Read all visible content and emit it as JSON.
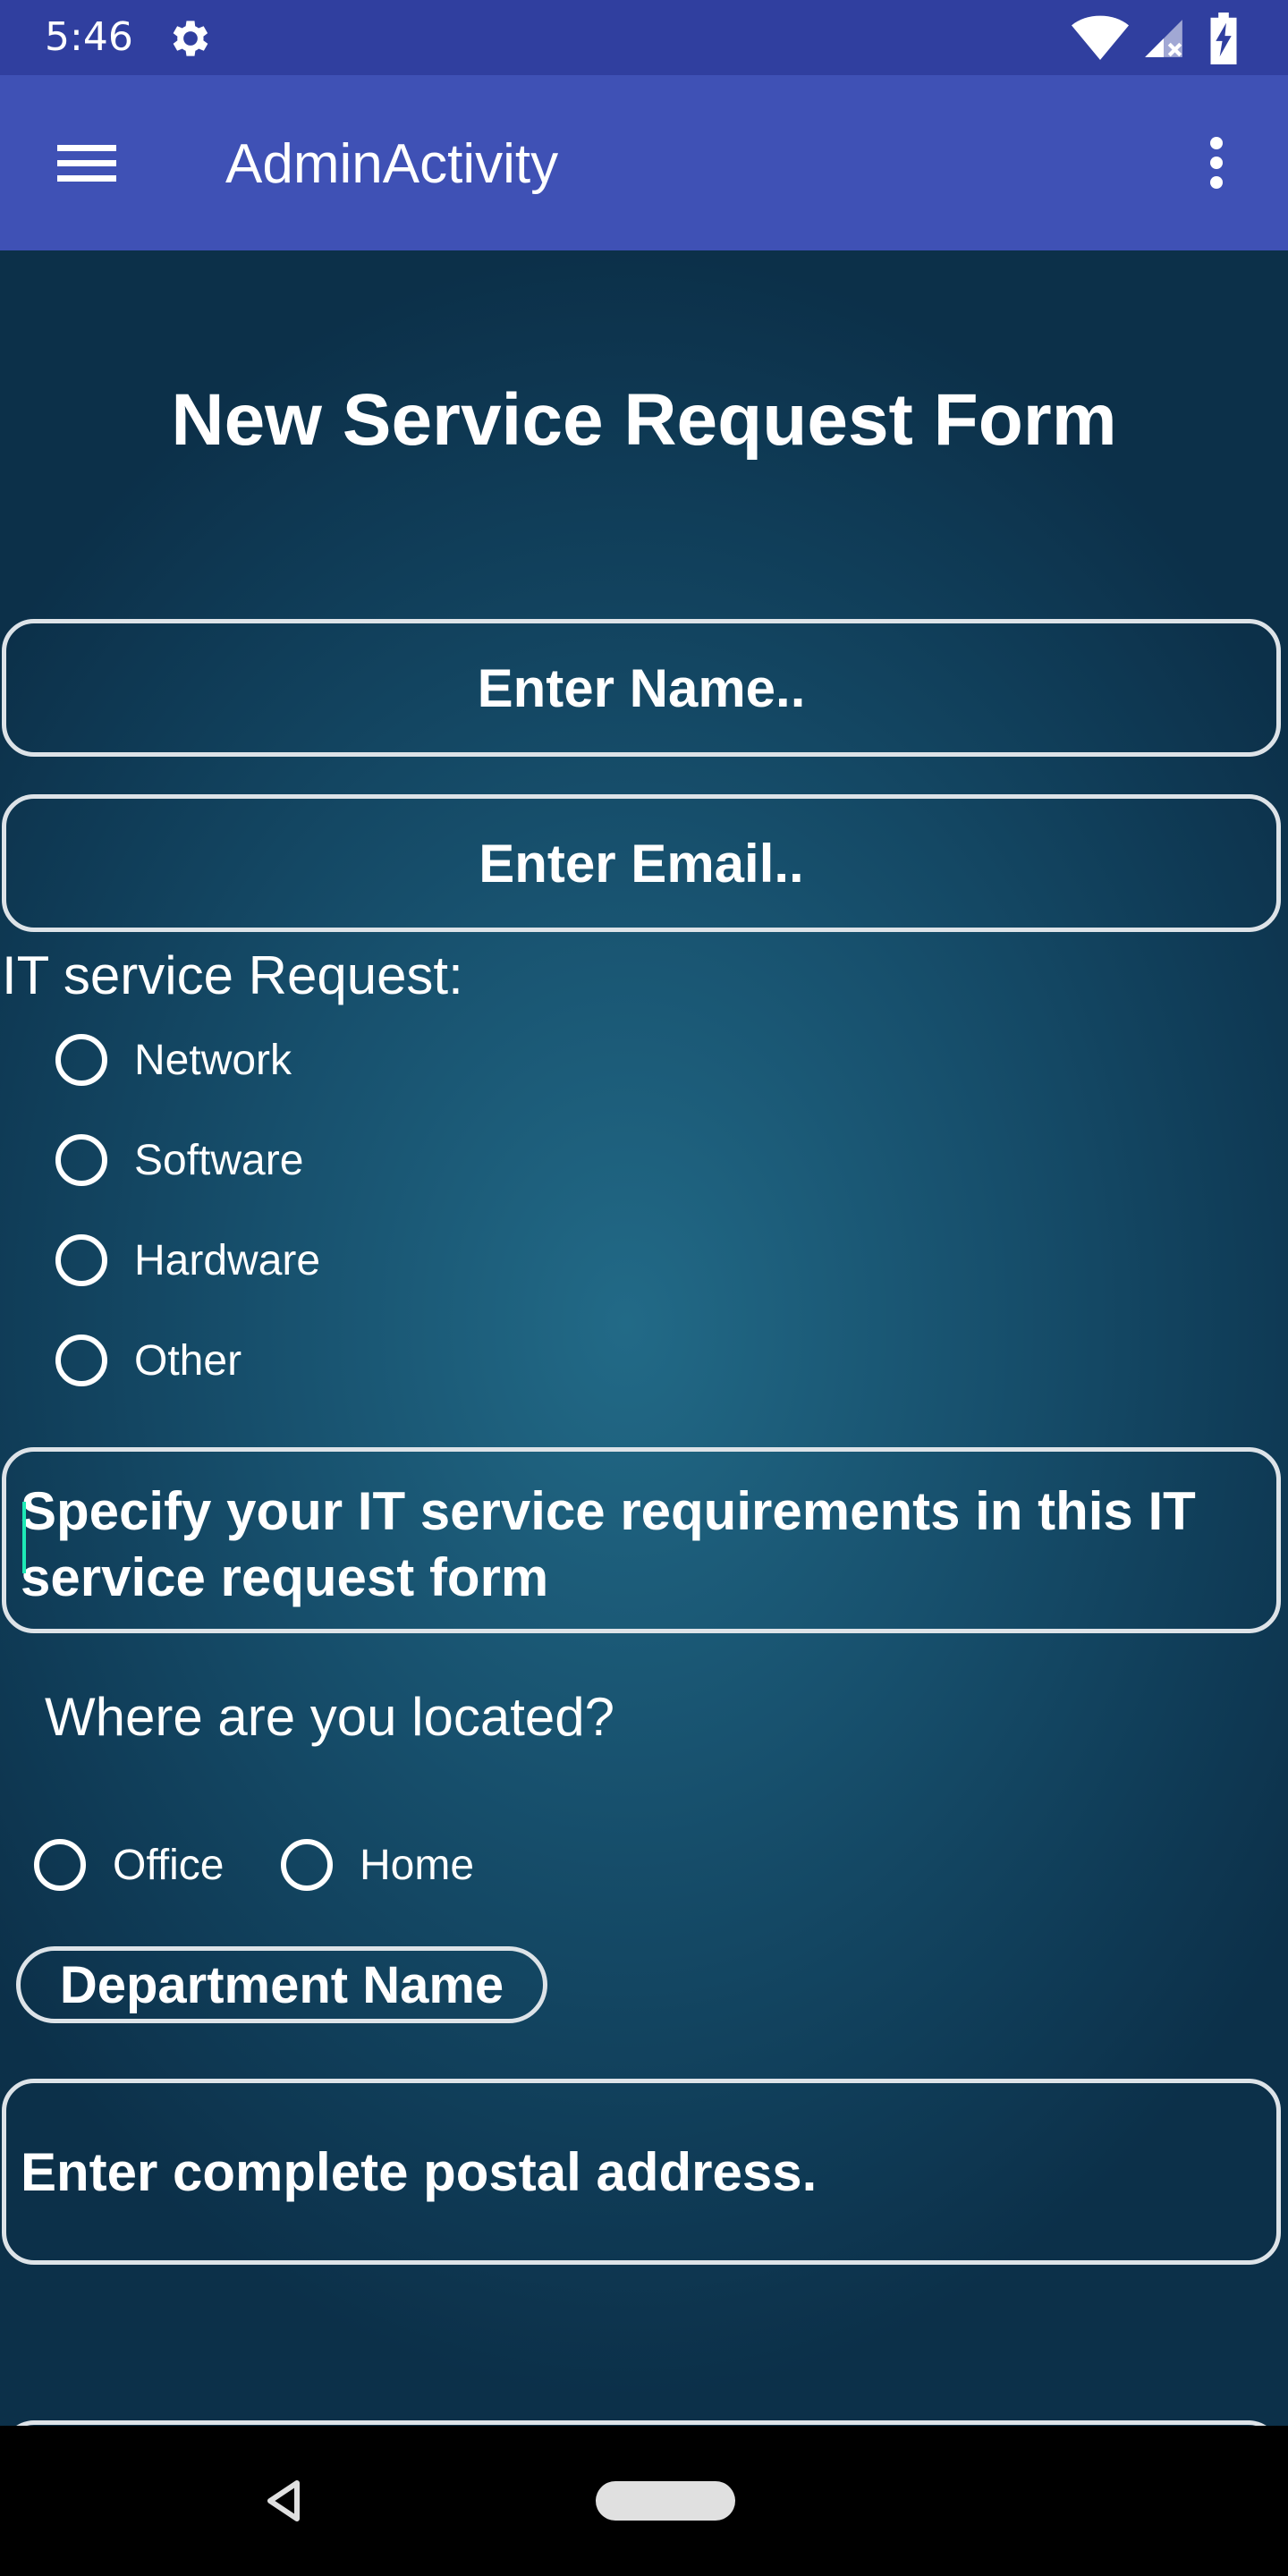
{
  "status_bar": {
    "time": "5:46",
    "icons": [
      "gear-icon",
      "wifi-icon",
      "signal-icon",
      "battery-icon"
    ]
  },
  "app_bar": {
    "title": "AdminActivity",
    "color": "#3f51b5"
  },
  "form": {
    "title": "New Service Request Form",
    "name_placeholder": "Enter Name..",
    "email_placeholder": "Enter Email..",
    "it_service_label": "IT service Request:",
    "it_service_options": [
      "Network",
      "Software",
      "Hardware",
      "Other"
    ],
    "requirements_text": "Specify your IT service requirements in this IT service request form",
    "location_label": "Where are you located?",
    "location_options": [
      "Office",
      "Home"
    ],
    "department_placeholder": "Department Name",
    "address_placeholder": "Enter complete postal address."
  },
  "fab": {
    "icon": "mail-icon",
    "color": "#1e9e57"
  },
  "nav_bar": {
    "icons": [
      "back-icon",
      "home-pill"
    ]
  }
}
